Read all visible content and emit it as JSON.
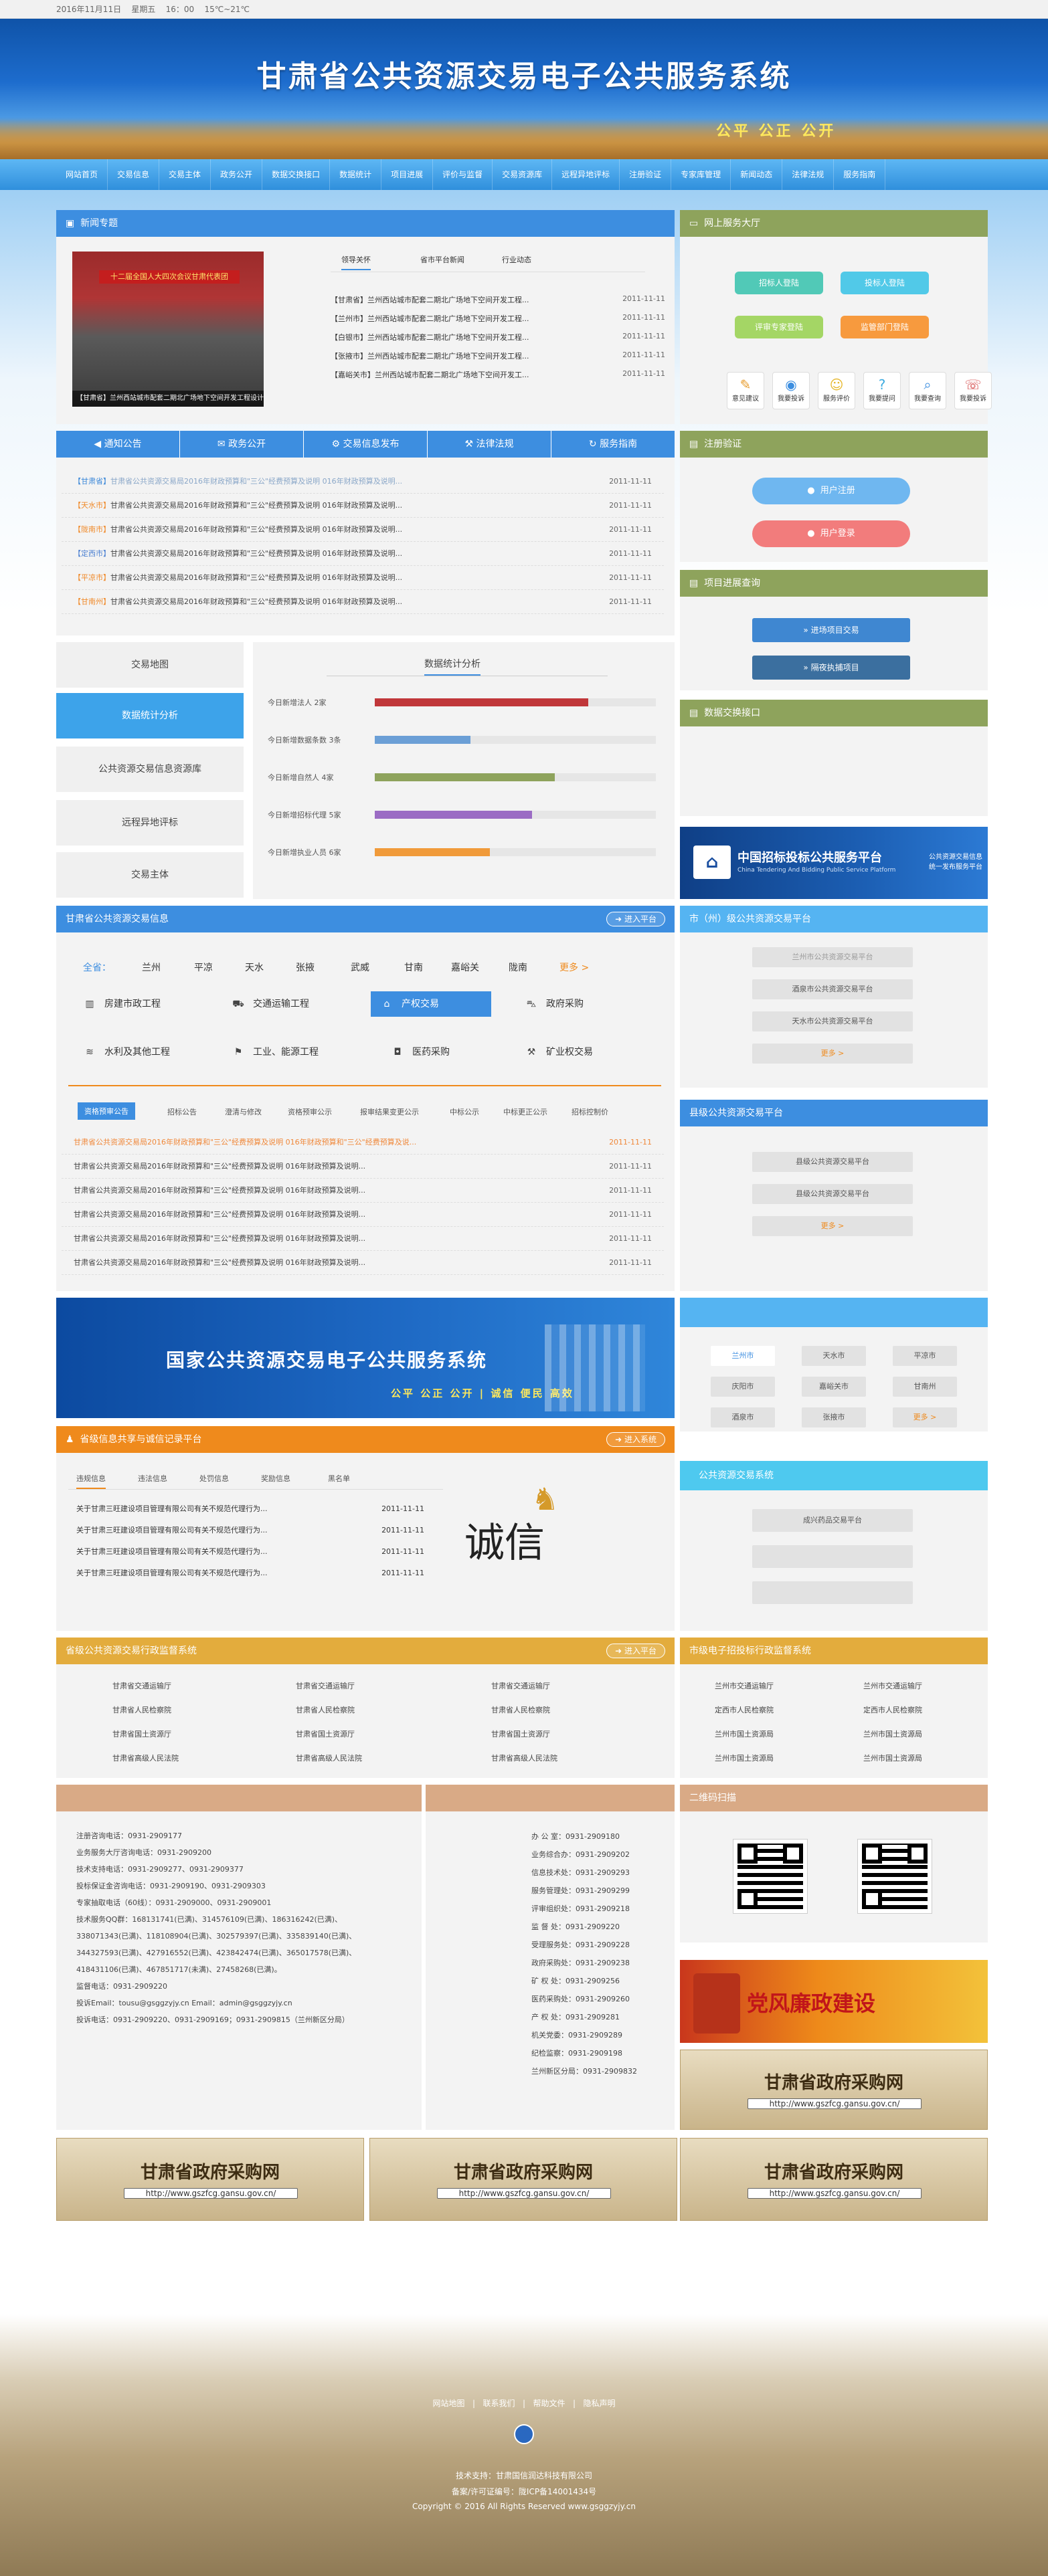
{
  "topbar": {
    "date": "2016年11月11日",
    "weekday": "星期五",
    "time": "16：00",
    "weather": "15℃~21℃"
  },
  "banner": {
    "title": "甘肃省公共资源交易电子公共服务系统",
    "slogan": "公平 公正 公开"
  },
  "nav": [
    "网站首页",
    "交易信息",
    "交易主体",
    "政务公开",
    "数据交换接口",
    "数据统计",
    "项目进展",
    "评价与监督",
    "交易资源库",
    "远程异地评标",
    "注册验证",
    "专家库管理",
    "新闻动态",
    "法律法规",
    "服务指南"
  ],
  "news": {
    "title": "新闻专题",
    "photo_caption": "【甘肃省】兰州西站城市配套二期北广场地下空间开发工程设计",
    "photo_banner": "十二届全国人大四次会议甘肃代表团",
    "tabs": [
      "领导关怀",
      "省市平台新闻",
      "行业动态"
    ],
    "items": [
      {
        "text": "【甘肃省】兰州西站城市配套二期北广场地下空间开发工程...",
        "date": "2011-11-11"
      },
      {
        "text": "【兰州市】兰州西站城市配套二期北广场地下空间开发工程...",
        "date": "2011-11-11"
      },
      {
        "text": "【白银市】兰州西站城市配套二期北广场地下空间开发工程...",
        "date": "2011-11-11"
      },
      {
        "text": "【张掖市】兰州西站城市配套二期北广场地下空间开发工程...",
        "date": "2011-11-11"
      },
      {
        "text": "【嘉峪关市】兰州西站城市配套二期北广场地下空间开发工...",
        "date": "2011-11-11"
      }
    ]
  },
  "online_hall": {
    "title": "网上服务大厅",
    "buttons": [
      "招标人登陆",
      "投标人登陆",
      "评审专家登陆",
      "监管部门登陆"
    ],
    "icons": [
      "意见建议",
      "我要投诉",
      "服务评价",
      "我要提问",
      "我要查询",
      "我要投诉"
    ]
  },
  "notice": {
    "tabs": [
      "通知公告",
      "政务公开",
      "交易信息发布",
      "法律法规",
      "服务指南"
    ],
    "items": [
      {
        "tag": "【甘肃省】",
        "text": "甘肃省公共资源交易局2016年财政预算和\"三公\"经费预算及说明 016年财政预算及说明...",
        "date": "2011-11-11"
      },
      {
        "tag": "【天水市】",
        "text": "甘肃省公共资源交易局2016年财政预算和\"三公\"经费预算及说明 016年财政预算及说明...",
        "date": "2011-11-11"
      },
      {
        "tag": "【陇南市】",
        "text": "甘肃省公共资源交易局2016年财政预算和\"三公\"经费预算及说明 016年财政预算及说明...",
        "date": "2011-11-11"
      },
      {
        "tag": "【定西市】",
        "text": "甘肃省公共资源交易局2016年财政预算和\"三公\"经费预算及说明 016年财政预算及说明...",
        "date": "2011-11-11"
      },
      {
        "tag": "【平凉市】",
        "text": "甘肃省公共资源交易局2016年财政预算和\"三公\"经费预算及说明 016年财政预算及说明...",
        "date": "2011-11-11"
      },
      {
        "tag": "【甘南州】",
        "text": "甘肃省公共资源交易局2016年财政预算和\"三公\"经费预算及说明 016年财政预算及说明...",
        "date": "2011-11-11"
      }
    ]
  },
  "register": {
    "title": "注册验证",
    "user_register": "用户注册",
    "user_login": "用户登录"
  },
  "progress": {
    "title": "项目进展查询",
    "btn1": "进场项目交易",
    "btn2": "隔夜执捕项目"
  },
  "data_iface": {
    "title": "数据交换接口"
  },
  "sidebar": [
    "交易地图",
    "数据统计分析",
    "公共资源交易信息资源库",
    "远程异地评标",
    "交易主体"
  ],
  "stats": {
    "title": "数据统计分析",
    "rows": [
      {
        "label": "今日新增法人",
        "count": "2家",
        "value": 0.76,
        "color": "#c0373a"
      },
      {
        "label": "今日新增数据条数",
        "count": "3条",
        "value": 0.34,
        "color": "#6b9fd6"
      },
      {
        "label": "今日新增自然人",
        "count": "4家",
        "value": 0.64,
        "color": "#8ea35c"
      },
      {
        "label": "今日新增招标代理",
        "count": "5家",
        "value": 0.56,
        "color": "#9b6cc4"
      },
      {
        "label": "今日新增执业人员",
        "count": "6家",
        "value": 0.41,
        "color": "#f09a3a"
      }
    ]
  },
  "ad1": {
    "title": "中国招标投标公共服务平台",
    "sub": "China Tendering And Bidding Public Service Platform",
    "right": "公共资源交易信息\n统一发布服务平台"
  },
  "gs_info": {
    "title": "甘肃省公共资源交易信息",
    "enter": "进入平台",
    "all": "全省：",
    "cities": [
      "兰州",
      "平凉",
      "天水",
      "张掖",
      "武威",
      "甘南",
      "嘉峪关",
      "陇南",
      "更多 >"
    ],
    "cats": [
      "房建市政工程",
      "交通运输工程",
      "产权交易",
      "政府采购",
      "水利及其他工程",
      "工业、能源工程",
      "医药采购",
      "矿业权交易"
    ],
    "subtabs": [
      "资格预审公告",
      "招标公告",
      "澄清与修改",
      "资格预审公示",
      "报审结果变更公示",
      "中标公示",
      "中标更正公示",
      "招标控制价"
    ],
    "items": [
      {
        "text": "甘肃省公共资源交易局2016年财政预算和\"三公\"经费预算及说明 016年财政预算和\"三公\"经费预算及说...",
        "date": "2011-11-11",
        "hl": true
      },
      {
        "text": "甘肃省公共资源交易局2016年财政预算和\"三公\"经费预算及说明 016年财政预算及说明...",
        "date": "2011-11-11",
        "hl": false
      },
      {
        "text": "甘肃省公共资源交易局2016年财政预算和\"三公\"经费预算及说明 016年财政预算及说明...",
        "date": "2011-11-11",
        "hl": false
      },
      {
        "text": "甘肃省公共资源交易局2016年财政预算和\"三公\"经费预算及说明 016年财政预算及说明...",
        "date": "2011-11-11",
        "hl": false
      },
      {
        "text": "甘肃省公共资源交易局2016年财政预算和\"三公\"经费预算及说明 016年财政预算及说明...",
        "date": "2011-11-11",
        "hl": false
      },
      {
        "text": "甘肃省公共资源交易局2016年财政预算和\"三公\"经费预算及说明 016年财政预算及说明...",
        "date": "2011-11-11",
        "hl": false
      }
    ]
  },
  "city_platform": {
    "title": "市（州）级公共资源交易平台",
    "items": [
      "兰州市公共资源交易平台",
      "酒泉市公共资源交易平台",
      "天水市公共资源交易平台"
    ],
    "more": "更多 >"
  },
  "county_platform": {
    "title": "县级公共资源交易平台",
    "items": [
      "县级公共资源交易平台",
      "县级公共资源交易平台"
    ],
    "more": "更多 >"
  },
  "national": {
    "title": "国家公共资源交易电子公共服务系统",
    "slogan": "公平 公正 公开 | 诚信 便民 高效"
  },
  "city_links": [
    "兰州市",
    "天水市",
    "平凉市",
    "庆阳市",
    "嘉峪关市",
    "甘南州",
    "酒泉市",
    "张掖市",
    "更多 >"
  ],
  "credit": {
    "title": "省级信息共享与诚信记录平台",
    "enter": "进入系统",
    "tabs": [
      "违规信息",
      "违法信息",
      "处罚信息",
      "奖励信息",
      "黑名单"
    ],
    "items": [
      {
        "text": "关于甘肃三旺建设项目管理有限公司有关不规范代理行为...",
        "date": "2011-11-11"
      },
      {
        "text": "关于甘肃三旺建设项目管理有限公司有关不规范代理行为...",
        "date": "2011-11-11"
      },
      {
        "text": "关于甘肃三旺建设项目管理有限公司有关不规范代理行为...",
        "date": "2011-11-11"
      },
      {
        "text": "关于甘肃三旺建设项目管理有限公司有关不规范代理行为...",
        "date": "2011-11-11"
      }
    ],
    "seal": "诚信"
  },
  "pub_sys": {
    "title": "公共资源交易系统",
    "items": [
      "成兴药品交易平台",
      "",
      ""
    ]
  },
  "prov_supervise": {
    "title": "省级公共资源交易行政监督系统",
    "enter": "进入平台",
    "items": [
      "甘肃省交通运输厅",
      "甘肃省交通运输厅",
      "甘肃省交通运输厅",
      "甘肃省人民检察院",
      "甘肃省人民检察院",
      "甘肃省人民检察院",
      "甘肃省国土资源厅",
      "甘肃省国土资源厅",
      "甘肃省国土资源厅",
      "甘肃省高级人民法院",
      "甘肃省高级人民法院",
      "甘肃省高级人民法院"
    ]
  },
  "city_supervise": {
    "title": "市级电子招投标行政监督系统",
    "items": [
      "兰州市交通运输厅",
      "兰州市交通运输厅",
      "定西市人民检察院",
      "定西市人民检察院",
      "兰州市国土资源局",
      "兰州市国土资源局",
      "兰州市国土资源局",
      "兰州市国土资源局"
    ]
  },
  "contacts1": [
    "注册咨询电话：0931-2909177",
    "业务服务大厅咨询电话：0931-2909200",
    "技术支持电话：0931-2909277、0931-2909377",
    "投标保证金咨询电话：0931-2909190、0931-2909303",
    "专家抽取电话（60线）：0931-2909000、0931-2909001",
    "技术服务QQ群：168131741(已满)、314576109(已满)、186316242(已满)、",
    "338071343(已满)、118108904(已满)、302579397(已满)、335839140(已满)、",
    "344327593(已满)、427916552(已满)、423842474(已满)、365017578(已满)、",
    "418431106(已满)、467851717(未满)、27458268(已满)。",
    "监督电话：0931-2909220",
    "投诉Email：tousu@gsggzyjy.cn   Email：admin@gsggzyjy.cn",
    "投诉电话：0931-2909220、0931-2909169；0931-2909815（兰州新区分局）"
  ],
  "contacts2": [
    "办 公 室：0931-2909180",
    "业务综合办：0931-2909202",
    "信息技术处：0931-2909293",
    "服务管理处：0931-2909299",
    "评审组织处：0931-2909218",
    "监 督 处：0931-2909220",
    "受理服务处：0931-2909228",
    "政府采购处：0931-2909238",
    "矿 权 处：0931-2909256",
    "医药采购处：0931-2909260",
    "产 权 处：0931-2909281",
    "机关党委：0931-2909289",
    "纪检监察：0931-2909198",
    "兰州新区分局：0931-2909832"
  ],
  "qr": {
    "title": "二维码扫描"
  },
  "ads": {
    "party": "党风廉政建设",
    "gs_title": "甘肃省政府采购网",
    "gs_url": "http://www.gszfcg.gansu.gov.cn/"
  },
  "footer": {
    "links": [
      "网站地图",
      "|",
      "联系我们",
      "|",
      "帮助文件",
      "|",
      "隐私声明"
    ],
    "support": "技术支持：甘肃国信润达科技有限公司",
    "icp": "备案/许可证编号：陇ICP备14001434号",
    "copyright": "Copyright © 2016 All Rights Reserved  www.gsggzyjy.cn"
  },
  "colors": {
    "blue": "#3d8ee0",
    "olive": "#8ea35c",
    "gold": "#e3ac3d",
    "orange": "#ef8a1c",
    "tan": "#d9aa86"
  }
}
